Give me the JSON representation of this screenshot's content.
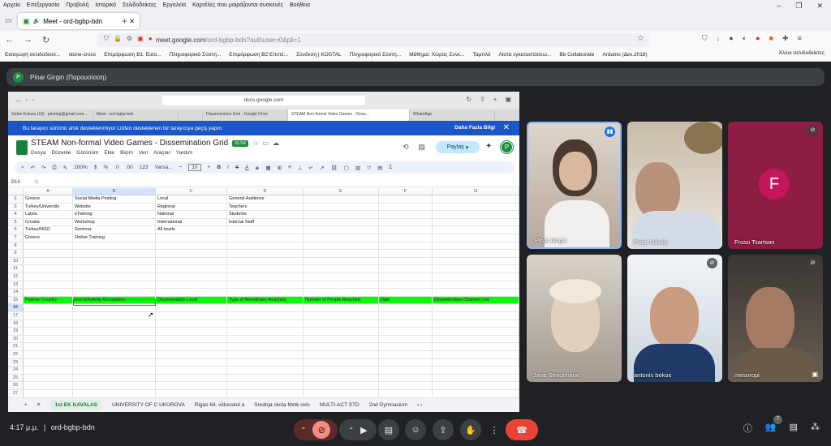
{
  "menubar": [
    "Αρχείο",
    "Επεξεργασία",
    "Προβολή",
    "Ιστορικό",
    "Σελιδοδείκτες",
    "Εργαλεία",
    "Καρτέλες που μοιράζονται συσκευές",
    "Βοήθεια"
  ],
  "browser": {
    "tab_title": "Meet - ord-bgbp-bdn",
    "url_host": "meet.google.com",
    "url_path": "/ord-bgbp-bdn?authuser=0&pli=1",
    "bookmarks": [
      "Εισαγωγή σελιδοδεικτ...",
      "stone-cross",
      "Επιμόρφωση Β1: Εισο...",
      "Πληροφορικό Σύστη...",
      "Επιμόρφωση Β2 Επιπέ...",
      "Σύνδεση | KOSTAL",
      "Πληροφορικό Σύστη...",
      "Μάθημα: Χώρος Συνε...",
      "Ταμπλό",
      "Λίστα εγκαταστάσεω...",
      "Bb Collaborate",
      "Arduino (Δεκ.2018)"
    ],
    "other_bookmarks": "Άλλοι σελιδοδείκτες"
  },
  "meet": {
    "presenter_initial": "P",
    "presenter_label": "Pinar Girgin (Παρουσίαση)",
    "meeting_code": "ord-bgbp-bdn",
    "time": "4:17 μ.μ.",
    "participant_count": "7"
  },
  "shared": {
    "mac_url": "docs.google.com",
    "inner_tabs": [
      "Gelen Kutusu (18) - pinmirg@gmail.com...",
      "Meet - ord-bgbp-bdn",
      "",
      "Dissemination Grid - Google Drive",
      "STEAM Non-formal Video Games - Disse...",
      "WhatsApp"
    ],
    "banner_text": "Bu tarayıcı sürümü artık desteklenmiyor Lütfen desteklenen bir tarayıcıya geçiş yapın.",
    "banner_more": "Daha Fazla Bilgi",
    "doc_title": "STEAM Non-formal Video Games - Dissemination Grid",
    "doc_badge": "XLSX",
    "doc_menu": [
      "Dosya",
      "Düzenle",
      "Görünüm",
      "Ekle",
      "Biçim",
      "Veri",
      "Araçlar",
      "Yardım"
    ],
    "share_label": "Paylaş",
    "avatar": "P",
    "toolbar": {
      "zoom": "100%",
      "percent": "%",
      "decimals": ".0",
      "decimals2": ".00",
      "fmt": "123",
      "font": "Varsa...",
      "size": "10"
    },
    "cell_ref": "B16",
    "fx": "fx",
    "columns": [
      "A",
      "B",
      "C",
      "D",
      "E",
      "F",
      "G"
    ],
    "rows": [
      {
        "n": "2",
        "cells": [
          "Greece",
          "Social Media Posting",
          "Local",
          "General Audience",
          "",
          "",
          ""
        ]
      },
      {
        "n": "3",
        "cells": [
          "Turkey/University",
          "Website",
          "Regional",
          "Teachers",
          "",
          "",
          ""
        ]
      },
      {
        "n": "4",
        "cells": [
          "Latvia",
          "eTwining",
          "National",
          "Students",
          "",
          "",
          ""
        ]
      },
      {
        "n": "5",
        "cells": [
          "Croatia",
          "Workshop",
          "International",
          "Internal Staff",
          "",
          "",
          ""
        ]
      },
      {
        "n": "6",
        "cells": [
          "Turkey/NGO",
          "Seminar",
          "All levels",
          "",
          "",
          "",
          ""
        ]
      },
      {
        "n": "7",
        "cells": [
          "Greece",
          "Online Training",
          "",
          "",
          "",
          "",
          ""
        ]
      },
      {
        "n": "8",
        "cells": [
          "",
          "",
          "",
          "",
          "",
          "",
          ""
        ]
      },
      {
        "n": "9",
        "cells": [
          "",
          "",
          "",
          "",
          "",
          "",
          ""
        ]
      },
      {
        "n": "10",
        "cells": [
          "",
          "",
          "",
          "",
          "",
          "",
          ""
        ]
      },
      {
        "n": "11",
        "cells": [
          "",
          "",
          "",
          "",
          "",
          "",
          ""
        ]
      },
      {
        "n": "12",
        "cells": [
          "",
          "",
          "",
          "",
          "",
          "",
          ""
        ]
      },
      {
        "n": "13",
        "cells": [
          "",
          "",
          "",
          "",
          "",
          "",
          ""
        ]
      },
      {
        "n": "14",
        "cells": [
          "",
          "",
          "",
          "",
          "",
          "",
          ""
        ]
      },
      {
        "n": "15",
        "cells": [
          "Partner Country",
          "Event/Activity Description",
          "Dissemination Level",
          "Type of Beneficiary Reached",
          "Number of People Reached",
          "Date",
          "Dissemination Channel Link"
        ],
        "header": true
      },
      {
        "n": "16",
        "cells": [
          "",
          "",
          "",
          "",
          "",
          "",
          ""
        ]
      },
      {
        "n": "17",
        "cells": [
          "",
          "",
          "",
          "",
          "",
          "",
          ""
        ]
      },
      {
        "n": "18",
        "cells": [
          "",
          "",
          "",
          "",
          "",
          "",
          ""
        ]
      },
      {
        "n": "19",
        "cells": [
          "",
          "",
          "",
          "",
          "",
          "",
          ""
        ]
      },
      {
        "n": "20",
        "cells": [
          "",
          "",
          "",
          "",
          "",
          "",
          ""
        ]
      },
      {
        "n": "21",
        "cells": [
          "",
          "",
          "",
          "",
          "",
          "",
          ""
        ]
      },
      {
        "n": "22",
        "cells": [
          "",
          "",
          "",
          "",
          "",
          "",
          ""
        ]
      },
      {
        "n": "23",
        "cells": [
          "",
          "",
          "",
          "",
          "",
          "",
          ""
        ]
      },
      {
        "n": "24",
        "cells": [
          "",
          "",
          "",
          "",
          "",
          "",
          ""
        ]
      },
      {
        "n": "25",
        "cells": [
          "",
          "",
          "",
          "",
          "",
          "",
          ""
        ]
      },
      {
        "n": "26",
        "cells": [
          "",
          "",
          "",
          "",
          "",
          "",
          ""
        ]
      },
      {
        "n": "27",
        "cells": [
          "",
          "",
          "",
          "",
          "",
          "",
          ""
        ]
      },
      {
        "n": "28",
        "cells": [
          "",
          "",
          "",
          "",
          "",
          "",
          ""
        ]
      }
    ],
    "sheet_tabs": [
      "1st EK KAVALAS",
      "UNIVERSITY OF C UKUROVA",
      "Rigas 64. vidusskol a",
      "Srednja skola Metk ovic",
      "MULTI-ACT STD",
      "2nd Gymnasium"
    ]
  },
  "participants": [
    {
      "name": "Pinar Girgin",
      "color": "#c9b8a8"
    },
    {
      "name": "Petar Nikolic",
      "color": "#a89a84"
    },
    {
      "name": "Froso Tsartsari",
      "initial": "F"
    },
    {
      "name": "Jana Strautmane",
      "color": "#b9b2aa"
    },
    {
      "name": "antonis bekos",
      "color": "#7b8a9a"
    },
    {
      "name": "mesoropi",
      "color": "#6e6258"
    }
  ]
}
